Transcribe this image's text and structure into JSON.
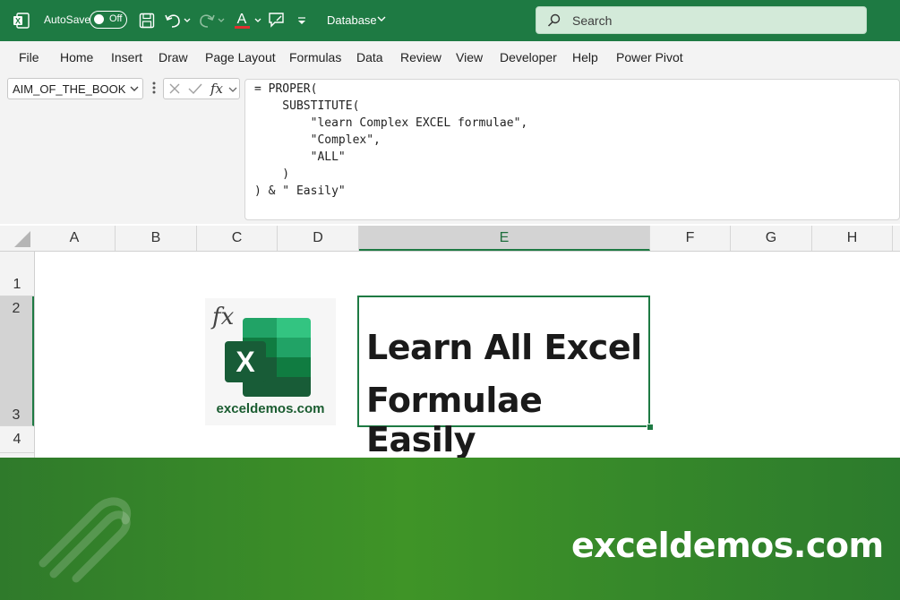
{
  "titlebar": {
    "autosave_label": "AutoSave",
    "autosave_state": "Off",
    "document_name": "Database",
    "search_placeholder": "Search"
  },
  "menu": [
    "File",
    "Home",
    "Insert",
    "Draw",
    "Page Layout",
    "Formulas",
    "Data",
    "Review",
    "View",
    "Developer",
    "Help",
    "Power Pivot"
  ],
  "formula_bar": {
    "name_box": "AIM_OF_THE_BOOK",
    "fx_label": "fx",
    "lines": [
      "= PROPER(",
      "    SUBSTITUTE(",
      "        \"learn Complex EXCEL formulae\",",
      "        \"Complex\",",
      "        \"ALL\"",
      "    )",
      ") & \" Easily\""
    ]
  },
  "grid": {
    "columns": [
      "A",
      "B",
      "C",
      "D",
      "E",
      "F",
      "G",
      "H"
    ],
    "selected_column": "E",
    "rows": [
      "1",
      "2",
      "3",
      "4"
    ],
    "cell_e2_lines": [
      "Learn All Excel",
      "Formulae Easily"
    ]
  },
  "logo": {
    "fx": "fx",
    "x_letter": "X",
    "caption": "exceldemos.com"
  },
  "footer": {
    "brand": "exceldemos.com"
  },
  "colors": {
    "excel_green": "#1e7a43",
    "footer_green": "#3f9427"
  }
}
